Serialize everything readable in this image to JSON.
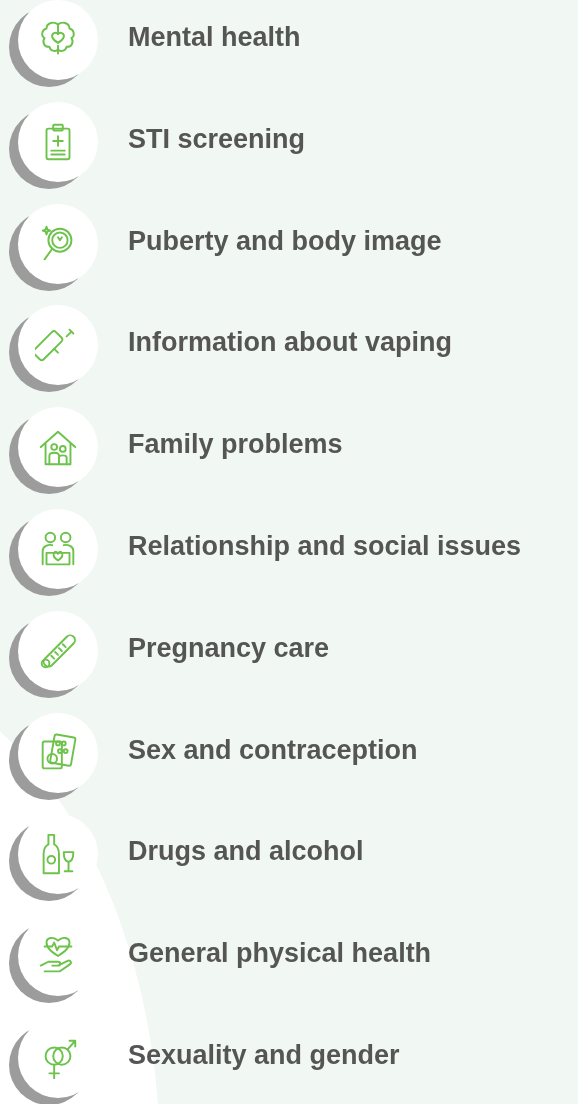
{
  "topics": [
    {
      "label": "Mental health"
    },
    {
      "label": "STI screening"
    },
    {
      "label": "Puberty and body image"
    },
    {
      "label": "Information about vaping"
    },
    {
      "label": "Family problems"
    },
    {
      "label": "Relationship and social issues"
    },
    {
      "label": "Pregnancy care"
    },
    {
      "label": "Sex and contraception"
    },
    {
      "label": "Drugs and alcohol"
    },
    {
      "label": "General physical health"
    },
    {
      "label": "Sexuality and gender"
    }
  ]
}
